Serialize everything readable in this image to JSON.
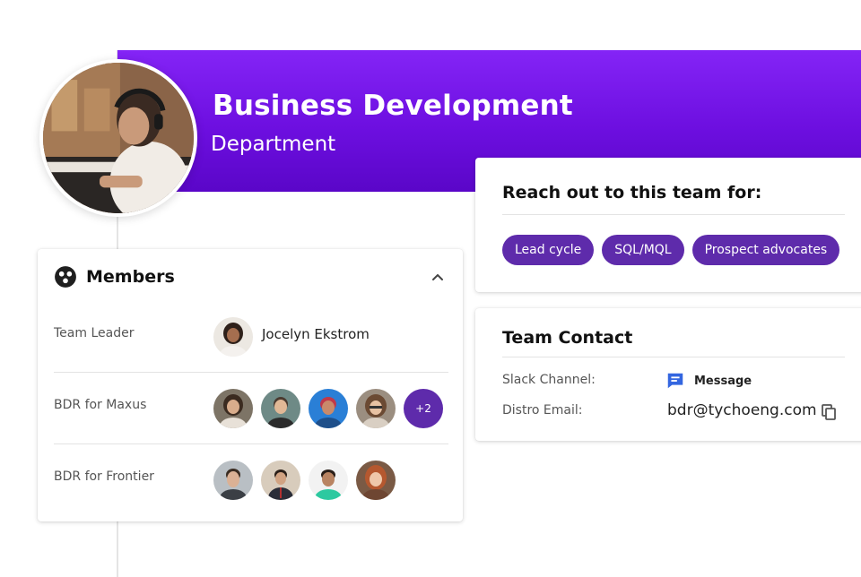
{
  "banner": {
    "title": "Business Development",
    "subtitle": "Department"
  },
  "members": {
    "title": "Members",
    "rows": [
      {
        "role": "Team Leader",
        "name": "Jocelyn Ekstrom"
      },
      {
        "role": "BDR for Maxus",
        "more": "+2"
      },
      {
        "role": "BDR for Frontier"
      }
    ]
  },
  "reach": {
    "title": "Reach out to this team for:",
    "chips": [
      "Lead cycle",
      "SQL/MQL",
      "Prospect advocates"
    ]
  },
  "contact": {
    "title": "Team Contact",
    "slack_label": "Slack Channel:",
    "slack_action": "Message",
    "email_label": "Distro Email:",
    "email": "bdr@tychoeng.com"
  },
  "colors": {
    "banner": "#6d0fe0",
    "chip": "#5e2bab",
    "message_icon": "#3366e0"
  },
  "icons": [
    "members-icon",
    "chevron-up-icon",
    "message-icon",
    "copy-icon"
  ]
}
